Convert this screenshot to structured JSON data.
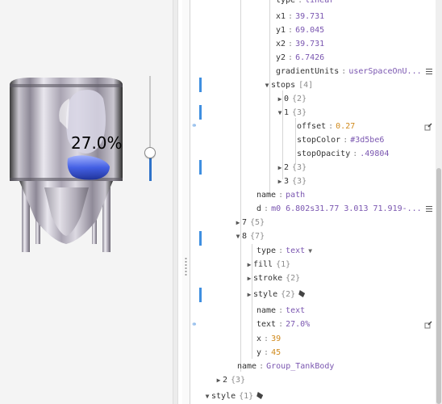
{
  "canvas": {
    "level_label": "27.0%",
    "level_value": 27.0,
    "accent": "#2f73c9"
  },
  "tree": {
    "r_type_key": "type",
    "r_type_val": "linear",
    "r_x1_key": "x1",
    "r_x1_val": "39.731",
    "r_y1_key": "y1",
    "r_y1_val": "69.045",
    "r_x2_key": "x2",
    "r_x2_val": "39.731",
    "r_y2_key": "y2",
    "r_y2_val": "6.7426",
    "r_gu_key": "gradientUnits",
    "r_gu_val": "userSpaceOnU...",
    "r_stops_key": "stops",
    "r_stops_cnt": "[4]",
    "r_s0_key": "0",
    "r_s0_cnt": "{2}",
    "r_s1_key": "1",
    "r_s1_cnt": "{3}",
    "r_off_key": "offset",
    "r_off_val": "0.27",
    "r_sc_key": "stopColor",
    "r_sc_val": "#3d5be6",
    "r_so_key": "stopOpacity",
    "r_so_val": ".49804",
    "r_s2_key": "2",
    "r_s2_cnt": "{3}",
    "r_s3_key": "3",
    "r_s3_cnt": "{3}",
    "r_name1_key": "name",
    "r_name1_val": "path",
    "r_d_key": "d",
    "r_d_val": "m0 6.802s31.77 3.013 71.919-...",
    "r_7_key": "7",
    "r_7_cnt": "{5}",
    "r_8_key": "8",
    "r_8_cnt": "{7}",
    "r_type2_key": "type",
    "r_type2_val": "text",
    "r_fill_key": "fill",
    "r_fill_cnt": "{1}",
    "r_stroke_key": "stroke",
    "r_stroke_cnt": "{2}",
    "r_style_key": "style",
    "r_style_cnt": "{2}",
    "r_name2_key": "name",
    "r_name2_val": "text",
    "r_text_key": "text",
    "r_text_val": "27.0%",
    "r_x_key": "x",
    "r_x_val": "39",
    "r_y_key": "y",
    "r_y_val": "45",
    "r_gname_key": "name",
    "r_gname_val": "Group_TankBody",
    "r_2_key": "2",
    "r_2_cnt": "{3}",
    "r_style2_key": "style",
    "r_style2_cnt": "{1}"
  },
  "icons": {
    "caret_right": "▶",
    "caret_down": "▼",
    "link": "link-icon",
    "menu": "menu-icon",
    "edit": "edit-icon"
  }
}
